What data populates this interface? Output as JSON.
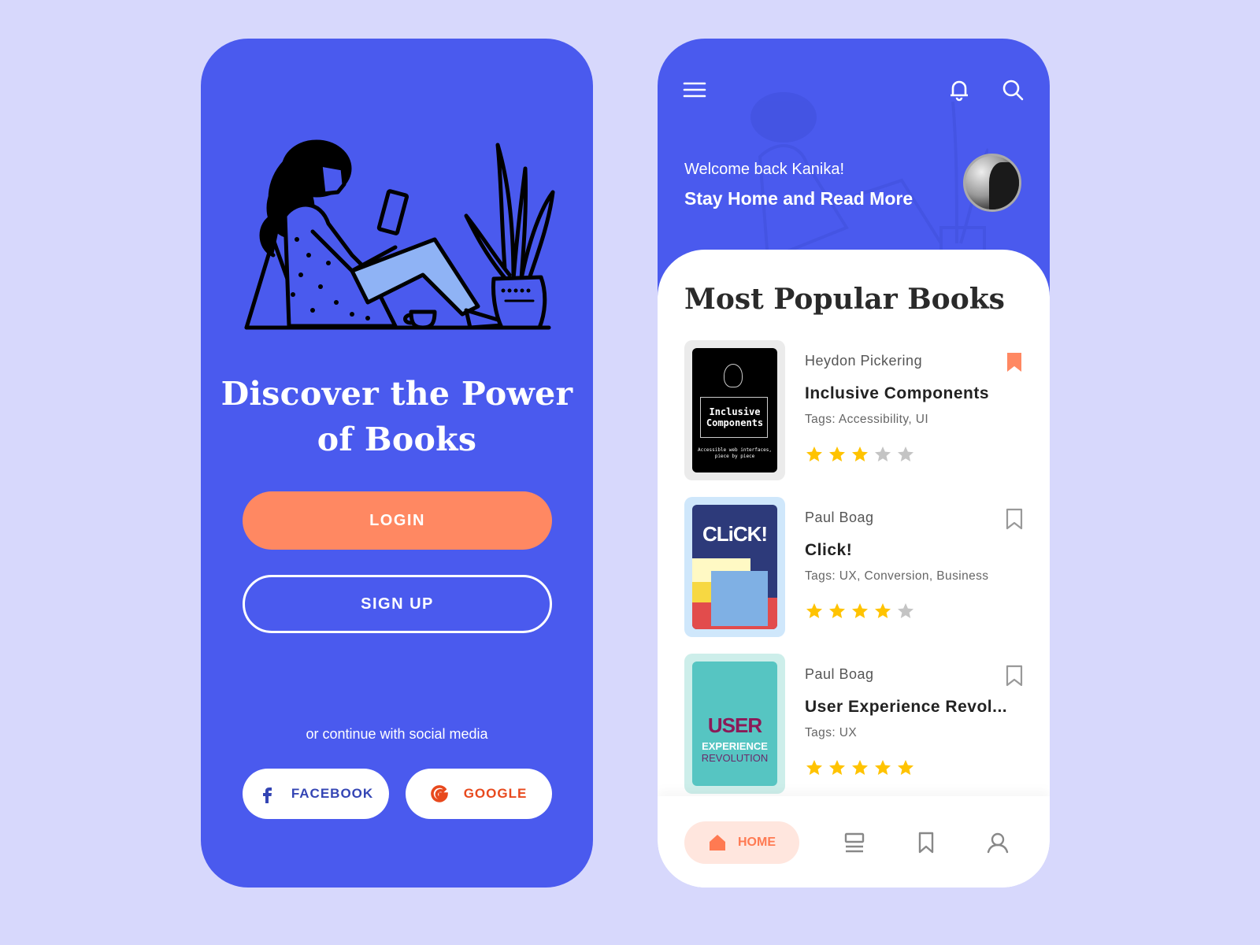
{
  "colors": {
    "background": "#d7d8fc",
    "primary": "#4a5aee",
    "accent": "#ff8862",
    "star_filled": "#ffc300",
    "star_empty": "#c4c4c4"
  },
  "login_screen": {
    "headline_line1": "Discover the Power",
    "headline_line2": "of Books",
    "login_label": "LOGIN",
    "signup_label": "SIGN UP",
    "social_prompt": "or continue with social media",
    "facebook_label": "FACEBOOK",
    "google_label": "GOOGLE"
  },
  "home_screen": {
    "welcome": "Welcome back Kanika!",
    "tagline": "Stay Home and Read More",
    "section_title": "Most Popular Books",
    "books": [
      {
        "author": "Heydon Pickering",
        "title": "Inclusive Components",
        "tags": "Tags: Accessibility, UI",
        "rating": 3,
        "bookmarked": true,
        "cover_title": "Inclusive Components",
        "cover_subtitle": "Accessible web interfaces, piece by piece"
      },
      {
        "author": "Paul Boag",
        "title": "Click!",
        "tags": "Tags: UX, Conversion, Business",
        "rating": 4,
        "bookmarked": false,
        "cover_title": "CLiCK!"
      },
      {
        "author": "Paul Boag",
        "title": "User Experience Revol...",
        "tags": "Tags: UX",
        "rating": 5,
        "bookmarked": false,
        "cover_title": "USER",
        "cover_subtitle1": "EXPERIENCE",
        "cover_subtitle2": "REVOLUTION"
      }
    ],
    "nav": {
      "home_label": "HOME",
      "active": "home"
    }
  }
}
